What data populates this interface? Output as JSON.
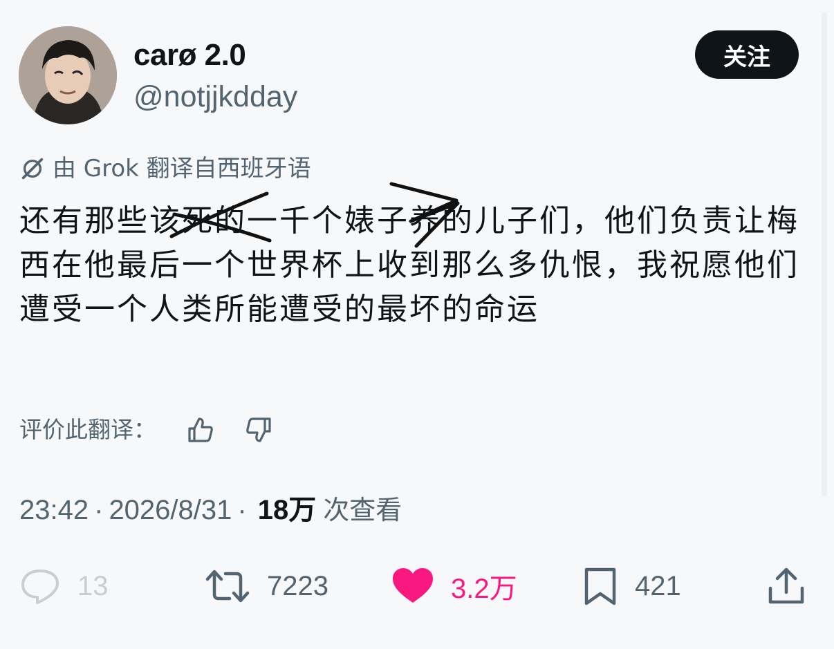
{
  "author": {
    "display_name": "carø 2.0",
    "handle": "@notjjkdday",
    "follow_label": "关注"
  },
  "translation": {
    "note": "由 Grok 翻译自西班牙语",
    "rate_label": "评价此翻译："
  },
  "tweet": {
    "text": "还有那些该死的一千个婊子养的儿子们，他们负责让梅西在他最后一个世界杯上收到那么多仇恨，我祝愿他们遭受一个人类所能遭受的最坏的命运"
  },
  "meta": {
    "time": "23:42",
    "date": "2026/8/31",
    "separator": "·",
    "views_count": "18万",
    "views_label": "次查看"
  },
  "actions": {
    "replies": "13",
    "retweets": "7223",
    "likes": "3.2万",
    "bookmarks": "421"
  },
  "colors": {
    "text": "#0f1419",
    "secondary": "#536471",
    "like": "#f91880",
    "muted": "#c9ced3",
    "background": "#f7f8fa"
  },
  "icons": [
    "grok-icon",
    "thumbs-up-icon",
    "thumbs-down-icon",
    "reply-icon",
    "retweet-icon",
    "heart-icon",
    "bookmark-icon",
    "share-icon"
  ]
}
